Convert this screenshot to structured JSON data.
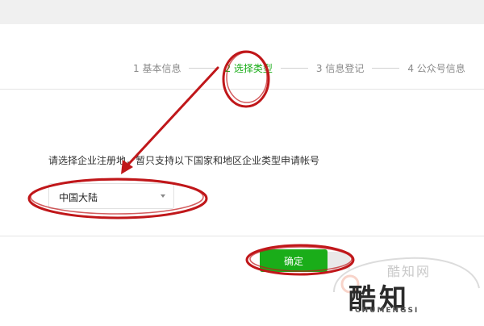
{
  "steps": [
    {
      "label": "1 基本信息",
      "active": false
    },
    {
      "label": "2 选择类型",
      "active": true
    },
    {
      "label": "3 信息登记",
      "active": false
    },
    {
      "label": "4 公众号信息",
      "active": false
    }
  ],
  "form": {
    "instruction": "请选择企业注册地，暂只支持以下国家和地区企业类型申请帐号",
    "region_select_value": "中国大陆",
    "confirm_label": "确定"
  },
  "watermark": {
    "cn_small": "酷知网",
    "cn_big": "酷知",
    "en": "CHUMENGSI"
  },
  "colors": {
    "accent": "#1aad19",
    "annotation": "#c0171a"
  }
}
